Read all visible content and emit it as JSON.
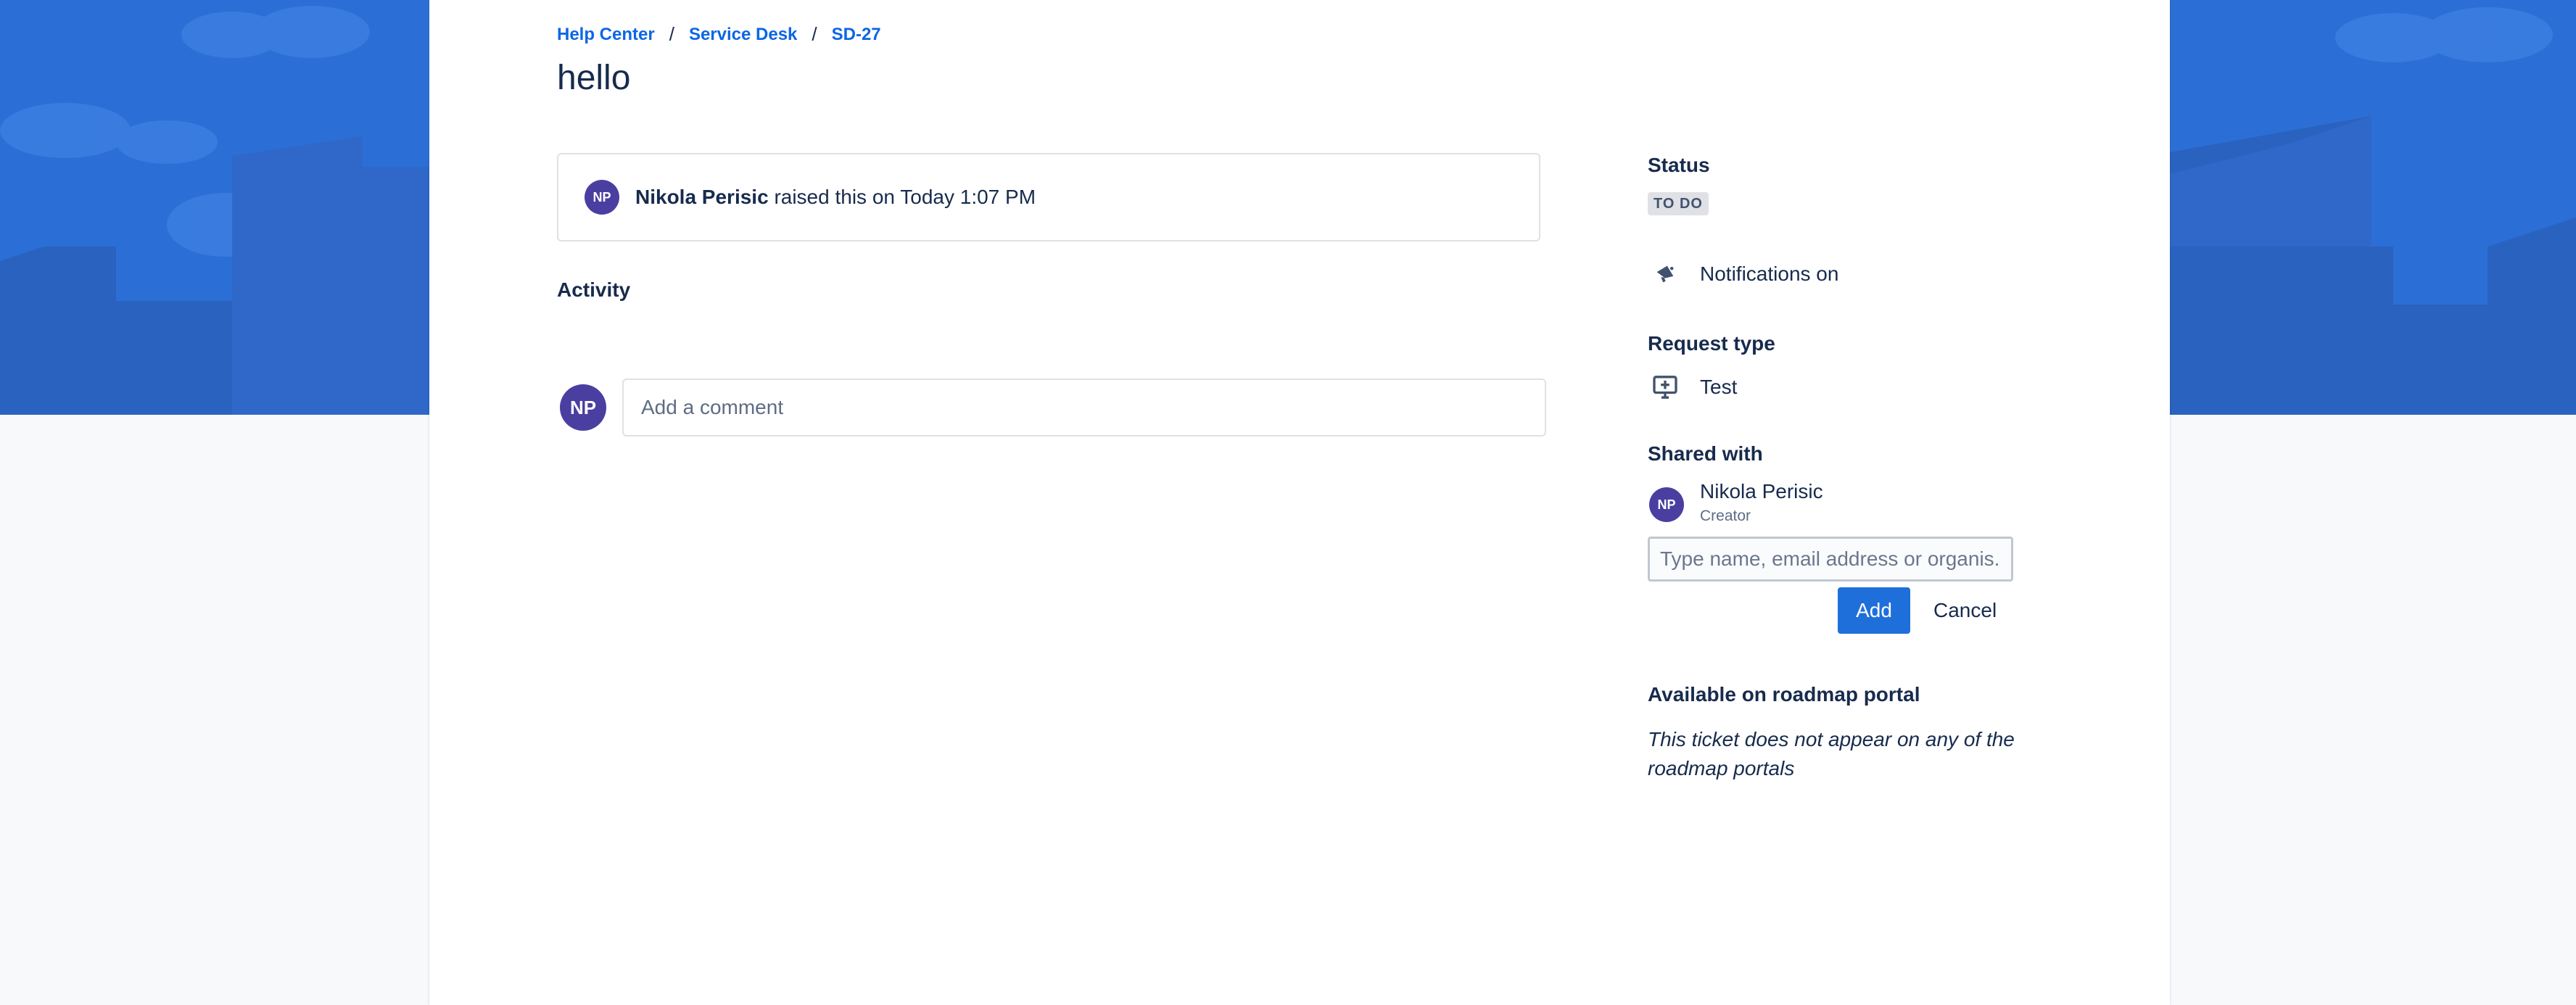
{
  "colors": {
    "banner": "#2b6fd6",
    "link": "#0c66e4",
    "avatar": "#4b3ea1",
    "primary_button": "#1f6fdb"
  },
  "breadcrumb": [
    "Help Center",
    "Service Desk",
    "SD-27"
  ],
  "breadcrumb_separator": "/",
  "request": {
    "title": "hello",
    "reporter_initials": "NP",
    "reporter_name": "Nikola Perisic",
    "raised_text": "raised this on Today 1:07 PM"
  },
  "activity": {
    "heading": "Activity",
    "avatar_initials": "NP",
    "comment_placeholder": "Add a comment"
  },
  "sidebar": {
    "status_label": "Status",
    "status_value": "TO DO",
    "notifications_icon": "megaphone-icon",
    "notifications_text": "Notifications on",
    "request_type_label": "Request type",
    "request_type_icon": "monitor-plus-icon",
    "request_type_value": "Test",
    "shared_with_label": "Shared with",
    "shared_user": {
      "initials": "NP",
      "name": "Nikola Perisic",
      "role": "Creator"
    },
    "share_placeholder": "Type name, email address or organis...",
    "add_button": "Add",
    "cancel_button": "Cancel",
    "roadmap_label": "Available on roadmap portal",
    "roadmap_text": "This ticket does not appear on any of the roadmap portals"
  }
}
